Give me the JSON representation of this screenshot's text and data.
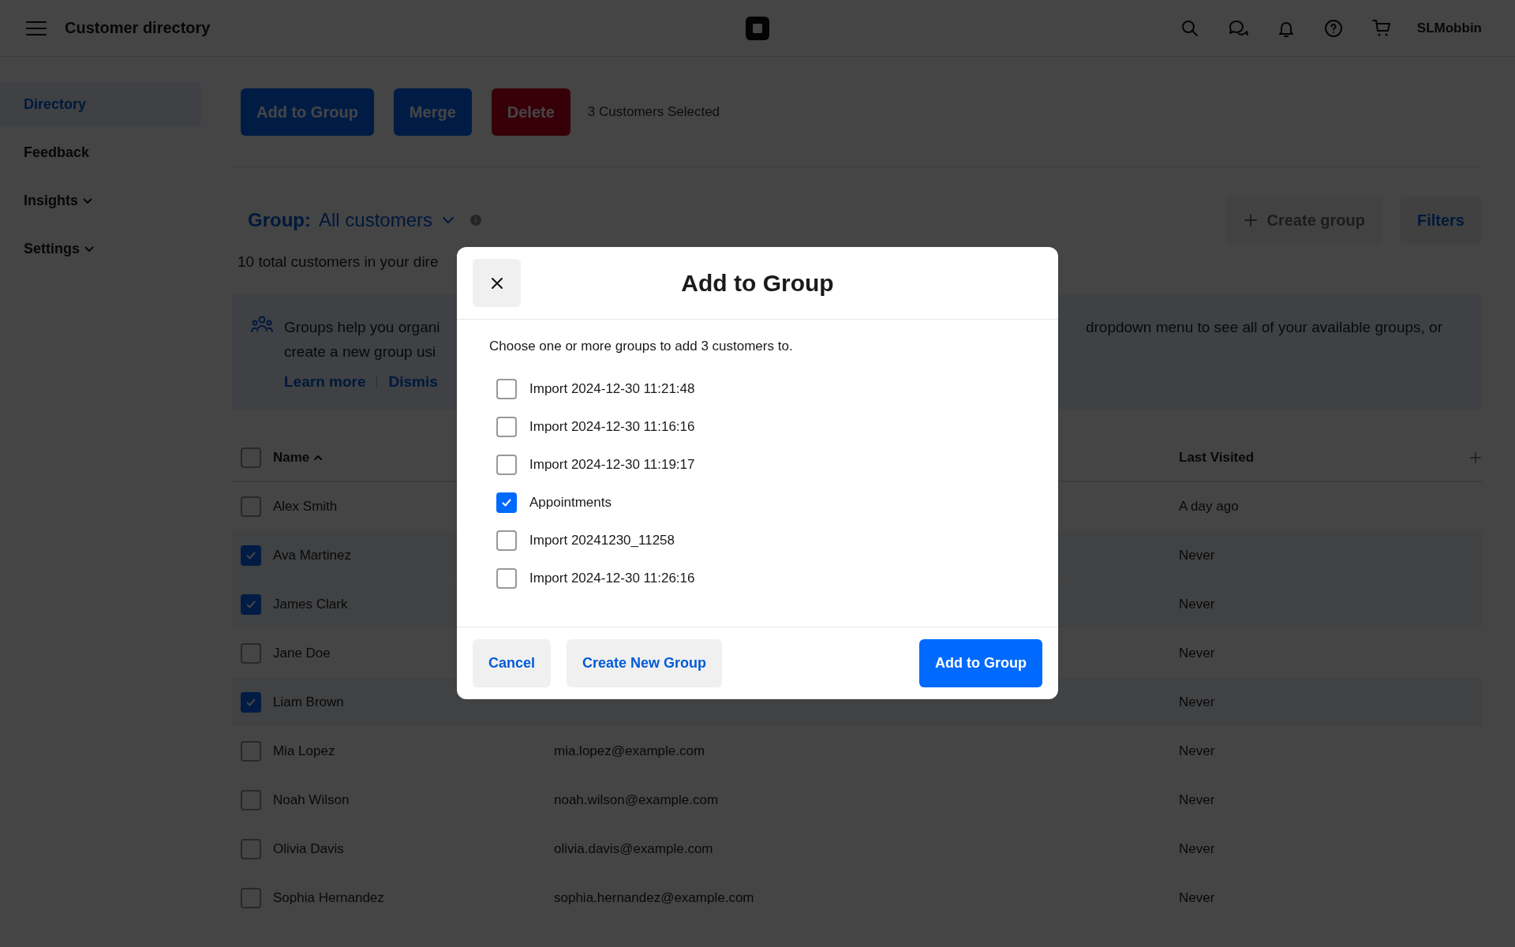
{
  "top_bar": {
    "title": "Customer directory",
    "user": "SLMobbin"
  },
  "sidebar": {
    "items": [
      {
        "label": "Directory",
        "selected": true,
        "expandable": false
      },
      {
        "label": "Feedback",
        "selected": false,
        "expandable": false
      },
      {
        "label": "Insights",
        "selected": false,
        "expandable": true
      },
      {
        "label": "Settings",
        "selected": false,
        "expandable": true
      }
    ]
  },
  "actions": {
    "buttons": [
      {
        "label": "Add to Group",
        "kind": "primary"
      },
      {
        "label": "Merge",
        "kind": "primary"
      },
      {
        "label": "Delete",
        "kind": "destructive"
      }
    ],
    "selection_text": "3 Customers Selected"
  },
  "group_bar": {
    "label": "Group:",
    "value": "All customers",
    "create_button": {
      "label": "Create group",
      "disabled": true
    },
    "filters_button": "Filters"
  },
  "summary": "10 total customers in your dire",
  "banner": {
    "left_lines": [
      "Groups help you organi",
      "create a new group usi"
    ],
    "right_lines": [
      "dropdown menu to see all of your available groups, or"
    ],
    "links": [
      "Learn more",
      "Dismis"
    ]
  },
  "table": {
    "select_all": false,
    "columns": [
      {
        "label": "Name",
        "sorted": true
      },
      {
        "label": "Last Visited",
        "sorted": false
      }
    ],
    "rows": [
      {
        "name": "Alex Smith",
        "last_visited": "A day ago",
        "selected": false
      },
      {
        "name": "Ava Martinez",
        "last_visited": "Never",
        "selected": true
      },
      {
        "name": "James Clark",
        "last_visited": "Never",
        "selected": true
      },
      {
        "name": "Jane Doe",
        "last_visited": "Never",
        "selected": false
      },
      {
        "name": "Liam Brown",
        "last_visited": "Never",
        "selected": true
      },
      {
        "name": "Mia Lopez",
        "email": "mia.lopez@example.com",
        "last_visited": "Never",
        "selected": false
      },
      {
        "name": "Noah Wilson",
        "email": "noah.wilson@example.com",
        "last_visited": "Never",
        "selected": false
      },
      {
        "name": "Olivia Davis",
        "email": "olivia.davis@example.com",
        "last_visited": "Never",
        "selected": false
      },
      {
        "name": "Sophia Hernandez",
        "email": "sophia.hernandez@example.com",
        "last_visited": "Never",
        "selected": false
      }
    ]
  },
  "modal": {
    "title": "Add to Group",
    "description": "Choose one or more groups to add 3 customers to.",
    "options": [
      {
        "label": "Import 2024-12-30 11:21:48",
        "checked": false
      },
      {
        "label": "Import 2024-12-30 11:16:16",
        "checked": false
      },
      {
        "label": "Import 2024-12-30 11:19:17",
        "checked": false
      },
      {
        "label": "Appointments",
        "checked": true
      },
      {
        "label": "Import 20241230_11258",
        "checked": false
      },
      {
        "label": "Import 2024-12-30 11:26:16",
        "checked": false
      }
    ],
    "buttons": [
      {
        "label": "Cancel",
        "kind": "secondary"
      },
      {
        "label": "Create New Group",
        "kind": "secondary"
      },
      {
        "label": "Add to Group",
        "kind": "primary"
      }
    ]
  }
}
